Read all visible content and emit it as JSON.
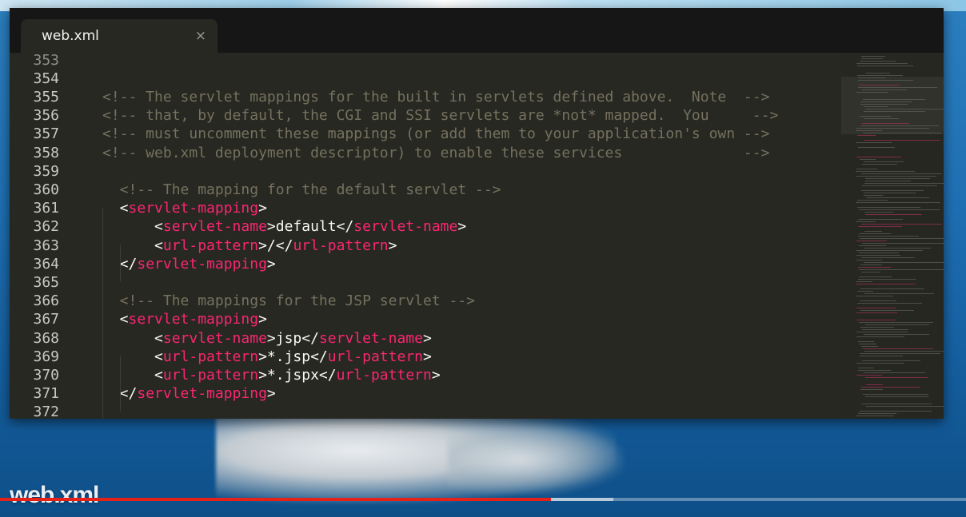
{
  "window": {
    "tab": {
      "label": "web.xml",
      "close_glyph": "×"
    }
  },
  "editor": {
    "lines": [
      {
        "num": "353",
        "partial": true,
        "segments": []
      },
      {
        "num": "354",
        "segments": []
      },
      {
        "num": "355",
        "segments": [
          {
            "t": "cm",
            "v": "<!-- The servlet mappings for the built in servlets defined above.  Note  -->"
          }
        ]
      },
      {
        "num": "356",
        "segments": [
          {
            "t": "cm",
            "v": "<!-- that, by default, the CGI and SSI servlets are *not* mapped.  You     -->"
          }
        ]
      },
      {
        "num": "357",
        "segments": [
          {
            "t": "cm",
            "v": "<!-- must uncomment these mappings (or add them to your application's own -->"
          }
        ]
      },
      {
        "num": "358",
        "segments": [
          {
            "t": "cm",
            "v": "<!-- web.xml deployment descriptor) to enable these services              -->"
          }
        ]
      },
      {
        "num": "359",
        "segments": []
      },
      {
        "num": "360",
        "segments": [
          {
            "t": "cm",
            "v": "  <!-- The mapping for the default servlet -->"
          }
        ]
      },
      {
        "num": "361",
        "segments": [
          {
            "t": "pn",
            "v": "  <"
          },
          {
            "t": "tg",
            "v": "servlet-mapping"
          },
          {
            "t": "pn",
            "v": ">"
          }
        ]
      },
      {
        "num": "362",
        "segments": [
          {
            "t": "pn",
            "v": "      <"
          },
          {
            "t": "tg",
            "v": "servlet-name"
          },
          {
            "t": "pn",
            "v": ">default</"
          },
          {
            "t": "tg",
            "v": "servlet-name"
          },
          {
            "t": "pn",
            "v": ">"
          }
        ]
      },
      {
        "num": "363",
        "segments": [
          {
            "t": "pn",
            "v": "      <"
          },
          {
            "t": "tg",
            "v": "url-pattern"
          },
          {
            "t": "pn",
            "v": ">/</"
          },
          {
            "t": "tg",
            "v": "url-pattern"
          },
          {
            "t": "pn",
            "v": ">"
          }
        ]
      },
      {
        "num": "364",
        "segments": [
          {
            "t": "pn",
            "v": "  </"
          },
          {
            "t": "tg",
            "v": "servlet-mapping"
          },
          {
            "t": "pn",
            "v": ">"
          }
        ]
      },
      {
        "num": "365",
        "segments": []
      },
      {
        "num": "366",
        "segments": [
          {
            "t": "cm",
            "v": "  <!-- The mappings for the JSP servlet -->"
          }
        ]
      },
      {
        "num": "367",
        "segments": [
          {
            "t": "pn",
            "v": "  <"
          },
          {
            "t": "tg",
            "v": "servlet-mapping"
          },
          {
            "t": "pn",
            "v": ">"
          }
        ]
      },
      {
        "num": "368",
        "segments": [
          {
            "t": "pn",
            "v": "      <"
          },
          {
            "t": "tg",
            "v": "servlet-name"
          },
          {
            "t": "pn",
            "v": ">jsp</"
          },
          {
            "t": "tg",
            "v": "servlet-name"
          },
          {
            "t": "pn",
            "v": ">"
          }
        ]
      },
      {
        "num": "369",
        "segments": [
          {
            "t": "pn",
            "v": "      <"
          },
          {
            "t": "tg",
            "v": "url-pattern"
          },
          {
            "t": "pn",
            "v": ">*.jsp</"
          },
          {
            "t": "tg",
            "v": "url-pattern"
          },
          {
            "t": "pn",
            "v": ">"
          }
        ]
      },
      {
        "num": "370",
        "segments": [
          {
            "t": "pn",
            "v": "      <"
          },
          {
            "t": "tg",
            "v": "url-pattern"
          },
          {
            "t": "pn",
            "v": ">*.jspx</"
          },
          {
            "t": "tg",
            "v": "url-pattern"
          },
          {
            "t": "pn",
            "v": ">"
          }
        ]
      },
      {
        "num": "371",
        "segments": [
          {
            "t": "pn",
            "v": "  </"
          },
          {
            "t": "tg",
            "v": "servlet-mapping"
          },
          {
            "t": "pn",
            "v": ">"
          }
        ]
      },
      {
        "num": "372",
        "segments": []
      }
    ]
  },
  "video": {
    "caption": "web.xml",
    "played_fraction": 0.57,
    "buffered_fraction": 0.635
  },
  "colors": {
    "background": "#272822",
    "comment": "#75715e",
    "tag": "#f92672",
    "text": "#f8f8f2",
    "progress": "#e62117"
  },
  "icons": {
    "tab_close": "close-icon",
    "minimap": "minimap"
  }
}
